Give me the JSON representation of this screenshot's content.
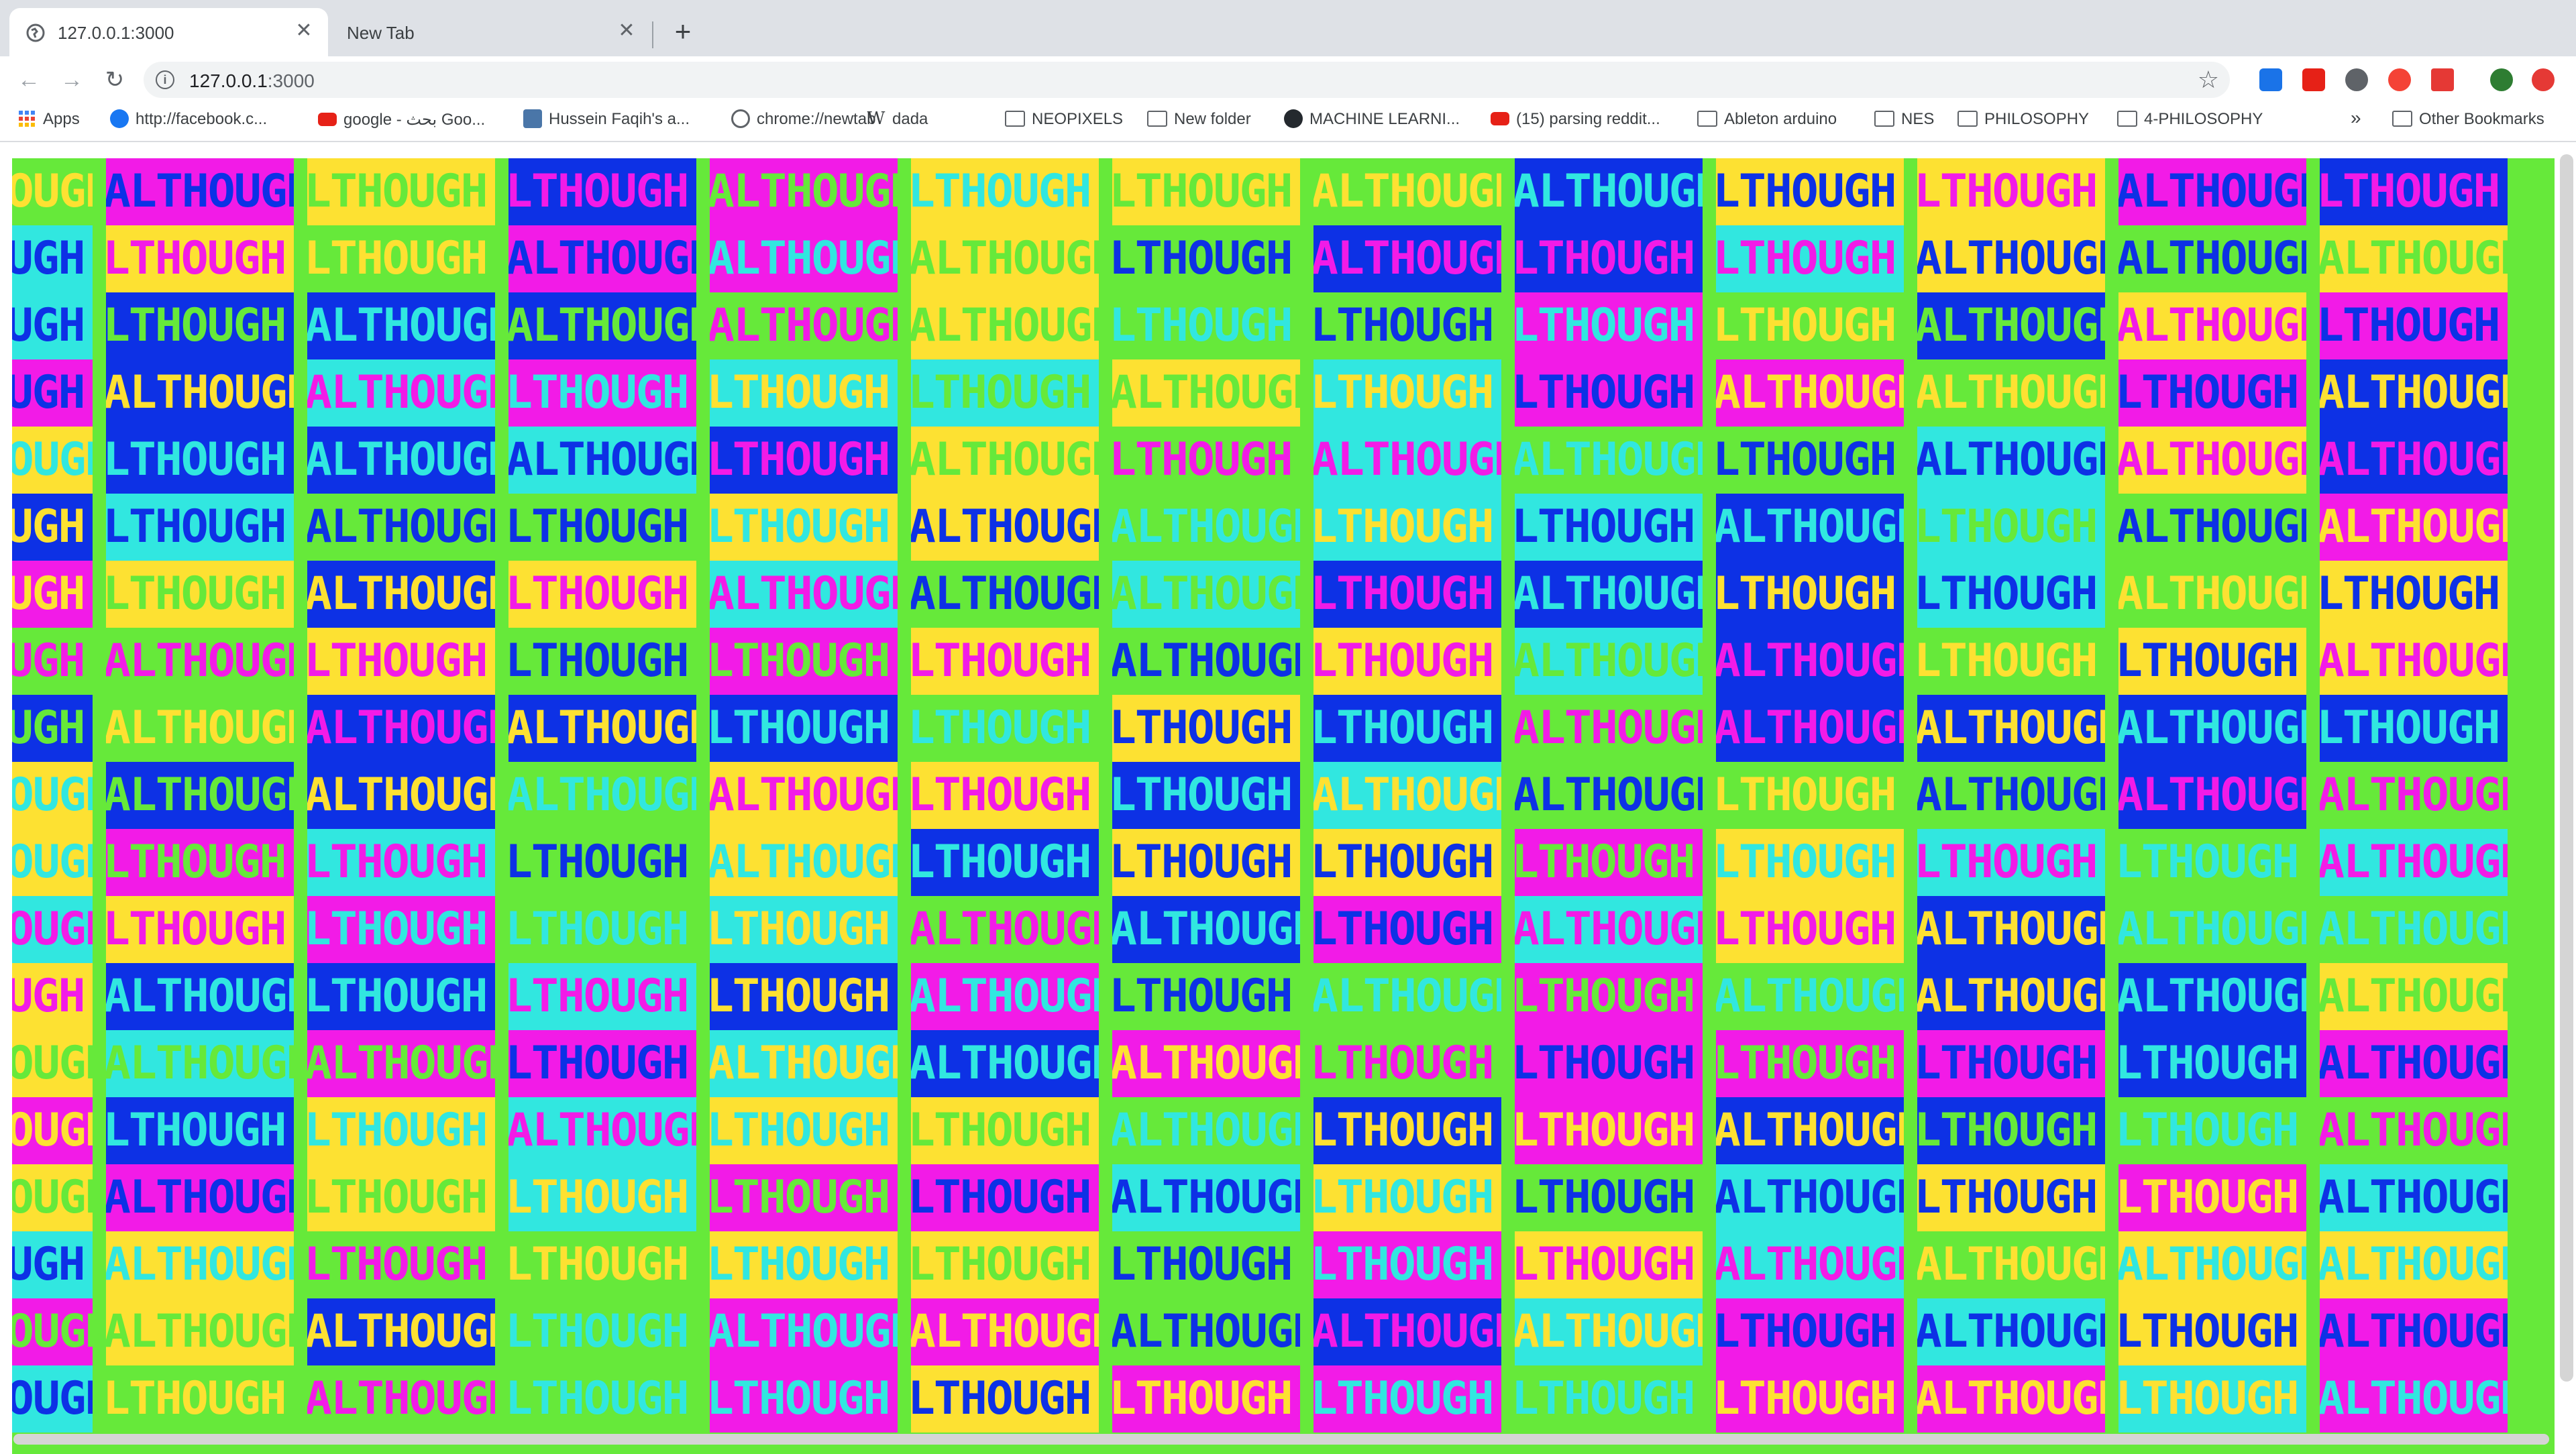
{
  "browser": {
    "tabs": [
      {
        "title": "127.0.0.1:3000",
        "active": true
      },
      {
        "title": "New Tab",
        "active": false
      }
    ],
    "new_tab_glyph": "+",
    "close_glyph": "✕",
    "url_host": "127.0.0.1",
    "url_port": ":3000",
    "info_glyph": "i",
    "nav": {
      "back": "←",
      "forward": "→",
      "reload": "↻"
    },
    "star_glyph": "☆",
    "bookmarks": [
      {
        "label": "Apps",
        "icon": "apps-grid-icon"
      },
      {
        "label": "http://facebook.c...",
        "icon": "facebook-icon"
      },
      {
        "label": "google - بحث Goo...",
        "icon": "youtube-icon"
      },
      {
        "label": "Hussein Faqih's a...",
        "icon": "vk-icon"
      },
      {
        "label": "chrome://newtab",
        "icon": "globe-icon"
      },
      {
        "label": "dada",
        "icon": "wikipedia-icon"
      },
      {
        "label": "NEOPIXELS",
        "icon": "folder-icon"
      },
      {
        "label": "New folder",
        "icon": "folder-icon"
      },
      {
        "label": "MACHINE LEARNI...",
        "icon": "github-icon"
      },
      {
        "label": "(15) parsing reddit...",
        "icon": "youtube-icon"
      },
      {
        "label": "Ableton arduino",
        "icon": "folder-icon"
      },
      {
        "label": "NES",
        "icon": "folder-icon"
      },
      {
        "label": "PHILOSOPHY",
        "icon": "folder-icon"
      },
      {
        "label": "4-PHILOSOPHY",
        "icon": "folder-icon"
      }
    ],
    "overflow": "»",
    "other_bookmarks": "Other Bookmarks"
  },
  "art": {
    "word": "ALTHOUGH",
    "colors": {
      "green": "#66e93a",
      "cyan": "#31e7e0",
      "magenta": "#f21be7",
      "blue": "#0d31e5",
      "yellow": "#fde132"
    },
    "palette": [
      "#66e93a",
      "#31e7e0",
      "#f21be7",
      "#0d31e5",
      "#fde132"
    ],
    "columns": 13,
    "rows": 19
  }
}
